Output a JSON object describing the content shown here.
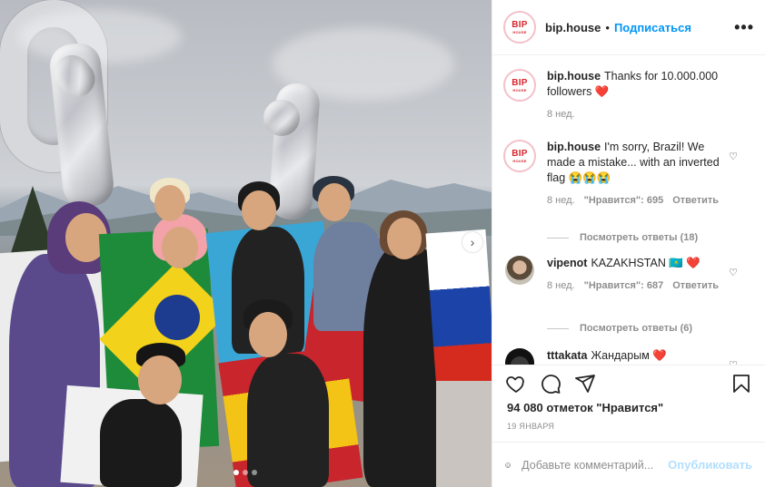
{
  "header": {
    "username": "bip.house",
    "dot": "•",
    "follow_label": "Подписаться",
    "more_label": "•••",
    "logo_top": "BIP",
    "logo_bottom": "HOUSE"
  },
  "comments": [
    {
      "username": "bip.house",
      "text": "Thanks for 10.000.000 followers ❤️",
      "time": "8 нед."
    },
    {
      "username": "bip.house",
      "text": "I'm sorry, Brazil! We made a mistake... with an inverted flag 😭😭😭",
      "time": "8 нед.",
      "likes": "\"Нравится\": 695",
      "reply_label": "Ответить",
      "view_replies": "Посмотреть ответы (18)"
    },
    {
      "username": "vipenot",
      "text": "KAZAKHSTAN 🇰🇿 ❤️",
      "time": "8 нед.",
      "likes": "\"Нравится\": 687",
      "reply_label": "Ответить",
      "view_replies": "Посмотреть ответы (6)"
    },
    {
      "username": "tttakata",
      "text": "Жандарым ❤️"
    }
  ],
  "stats": {
    "likes": "94 080 отметок \"Нравится\"",
    "date": "19 ЯНВАРЯ"
  },
  "add_comment": {
    "placeholder": "Добавьте комментарий...",
    "publish_label": "Опубликовать"
  },
  "colors": {
    "accent": "#0095f6",
    "publish_disabled": "#b2dffc",
    "logo_red": "#d8262f",
    "heart": "#ed4956"
  },
  "icons": {
    "like": "heart-icon",
    "comment": "comment-icon",
    "share": "share-icon",
    "save": "bookmark-icon",
    "emoji": "emoji-icon",
    "next": "chevron-right-icon"
  },
  "carousel": {
    "slides": 3,
    "active": 0
  }
}
